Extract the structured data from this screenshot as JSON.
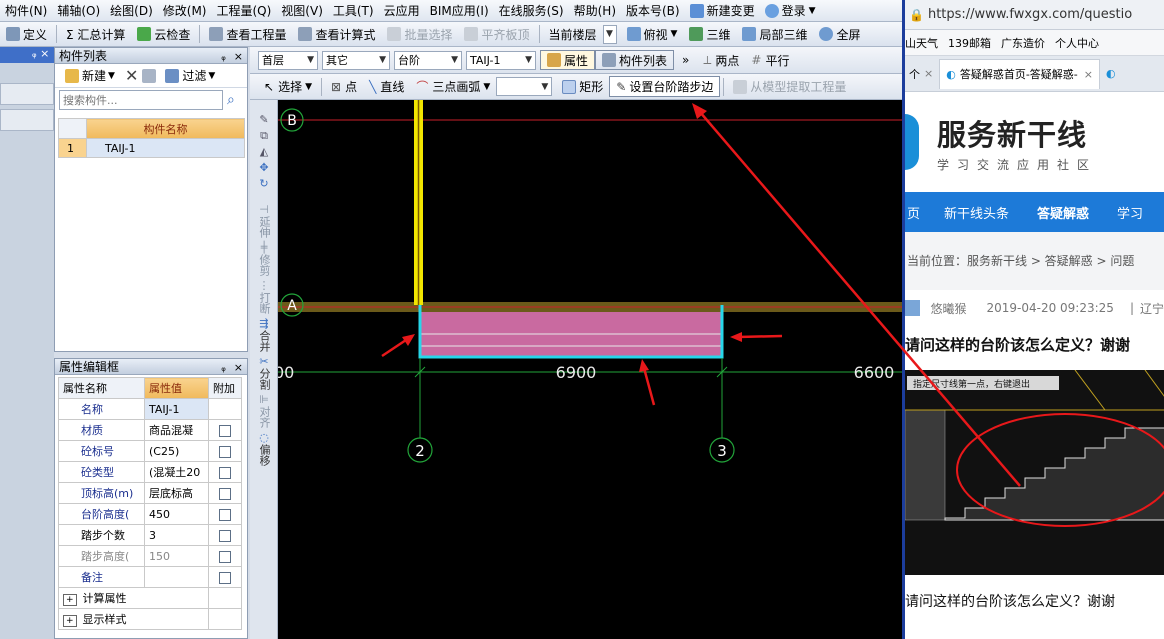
{
  "menu": [
    "构件(N)",
    "辅轴(O)",
    "绘图(D)",
    "修改(M)",
    "工程量(Q)",
    "视图(V)",
    "工具(T)",
    "云应用",
    "BIM应用(I)",
    "在线服务(S)",
    "帮助(H)",
    "版本号(B)",
    "新建变更",
    "登录"
  ],
  "toolbar1": [
    "定义",
    "Σ 汇总计算",
    "云检查",
    "查看工程量",
    "查看计算式",
    "批量选择",
    "平齐板顶",
    "当前楼层",
    "俯视",
    "三维",
    "局部三维",
    "全屏"
  ],
  "ctx1": {
    "floor": "首层",
    "type": "其它",
    "subtype": "台阶",
    "component": "TAIJ-1",
    "btn_attr": "属性",
    "btn_list": "构件列表",
    "two_points": "两点",
    "parallel": "平行"
  },
  "ctx2": {
    "select": "选择",
    "point": "点",
    "line": "直线",
    "arc": "三点画弧",
    "rect": "矩形",
    "set_step": "设置台阶踏步边",
    "extract": "从模型提取工程量"
  },
  "comp_list": {
    "title": "构件列表",
    "new": "新建",
    "filter": "过滤",
    "search_placeholder": "搜索构件...",
    "header": "构件名称",
    "rows": [
      {
        "idx": "1",
        "name": "TAIJ-1"
      }
    ]
  },
  "props": {
    "title": "属性编辑框",
    "headers": [
      "属性名称",
      "属性值",
      "附加"
    ],
    "rows": [
      {
        "name": "名称",
        "value": "TAIJ-1",
        "check": false,
        "gray": false
      },
      {
        "name": "材质",
        "value": "商品混凝",
        "check": true,
        "gray": false
      },
      {
        "name": "砼标号",
        "value": "(C25)",
        "check": true,
        "gray": false
      },
      {
        "name": "砼类型",
        "value": "(混凝土20",
        "check": true,
        "gray": false
      },
      {
        "name": "顶标高(m)",
        "value": "层底标高",
        "check": true,
        "gray": false
      },
      {
        "name": "台阶高度(",
        "value": "450",
        "check": true,
        "gray": false
      },
      {
        "name": "踏步个数",
        "value": "3",
        "check": true,
        "gray": false
      },
      {
        "name": "踏步高度(",
        "value": "150",
        "check": true,
        "gray": true
      },
      {
        "name": "备注",
        "value": "",
        "check": true,
        "gray": false
      }
    ],
    "groups": [
      "计算属性",
      "显示样式"
    ]
  },
  "vtools": [
    "延伸",
    "修剪",
    "打断",
    "合并",
    "分割",
    "对齐",
    "偏移"
  ],
  "canvas": {
    "axis_b": "B",
    "axis_a": "A",
    "axis_2": "2",
    "axis_3": "3",
    "dim_left": "00",
    "dim_mid": "6900",
    "dim_right": "6600"
  },
  "browser": {
    "url": "https://www.fwxgx.com/questio",
    "bookmarks": [
      "山天气",
      "139邮箱",
      "广东造价",
      "个人中心"
    ],
    "tab1": "答疑解惑首页-答疑解惑-",
    "tab_close": "×",
    "tab_prefix": "个",
    "logo_title": "服务新干线",
    "logo_sub": "学习交流应用社区",
    "nav": [
      "页",
      "新干线头条",
      "答疑解惑",
      "学习"
    ],
    "breadcrumb": "当前位置：服务新干线 > 答疑解惑 > 问题",
    "user": "悠曦猴",
    "datetime": "2019-04-20 09:23:25",
    "location": "辽宁",
    "question": "请问这样的台阶该怎么定义？谢谢",
    "cad_hint": "指定尺寸线第一点，右键退出",
    "caption": "请问这样的台阶该怎么定义？谢谢"
  }
}
